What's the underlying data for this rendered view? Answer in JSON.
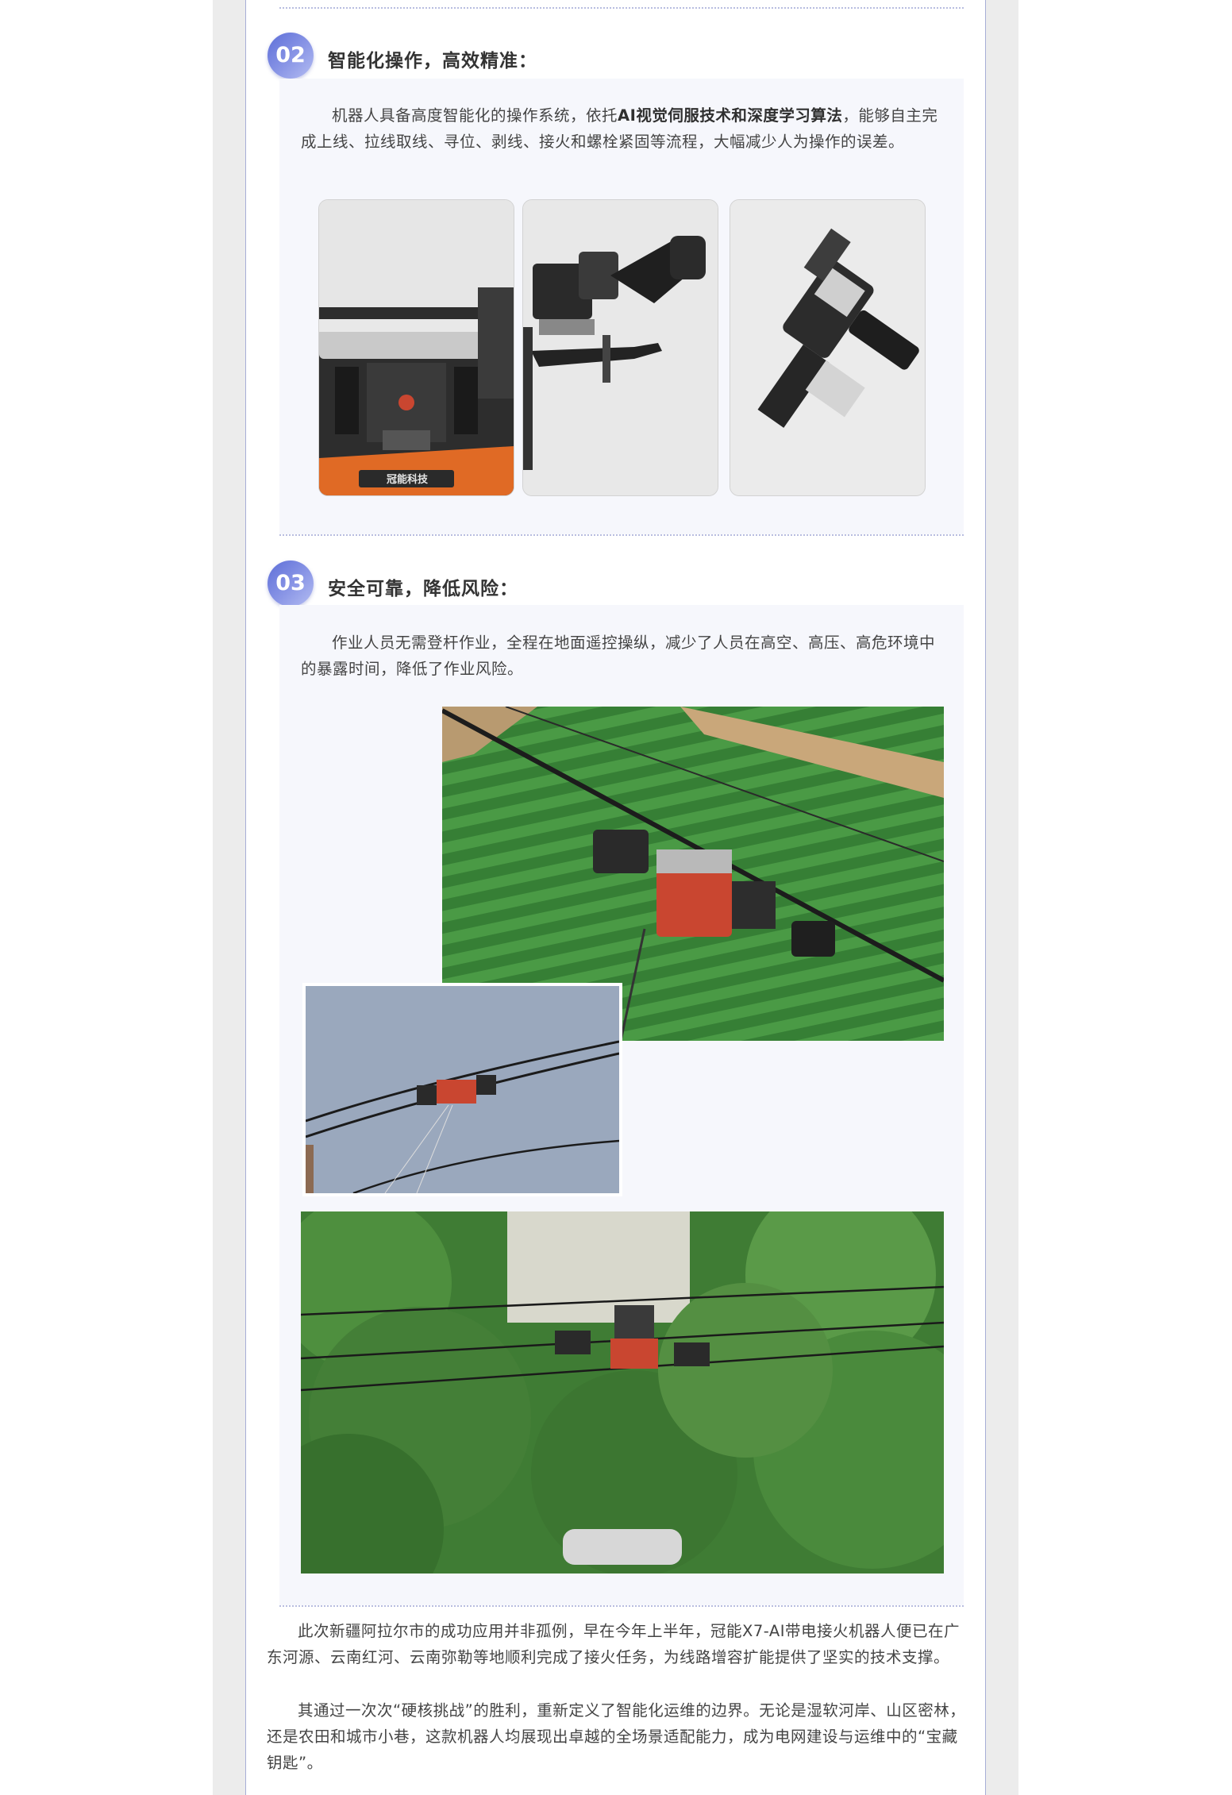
{
  "section02": {
    "number": "02",
    "title": "智能化操作，高效精准：",
    "para_before": "机器人具备高度智能化的操作系统，依托",
    "para_bold": "AI视觉伺服技术和深度学习算法",
    "para_after": "，能够自主完成上线、拉线取线、寻位、剥线、接火和螺栓紧固等流程，大幅减少人为操作的误差。",
    "images": [
      {
        "name": "robot-front-closeup",
        "logo_text": "冠能科技"
      },
      {
        "name": "robot-arm-gripper"
      },
      {
        "name": "robot-wrench-tool"
      }
    ]
  },
  "section03": {
    "number": "03",
    "title": "安全可靠，降低风险：",
    "paragraph": "作业人员无需登杆作业，全程在地面遥控操纵，减少了人员在高空、高压、高危环境中的暴露时间，降低了作业风险。",
    "images": [
      {
        "name": "robot-over-farmland"
      },
      {
        "name": "robot-on-line-sky"
      },
      {
        "name": "robot-among-trees"
      }
    ]
  },
  "closing": {
    "paragraph1": "此次新疆阿拉尔市的成功应用并非孤例，早在今年上半年，冠能X7-AI带电接火机器人便已在广东河源、云南红河、云南弥勒等地顺利完成了接火任务，为线路增容扩能提供了坚实的技术支撑。",
    "paragraph2": "其通过一次次“硬核挑战”的胜利，重新定义了智能化运维的边界。无论是湿软河岸、山区密林，还是农田和城市小巷，这款机器人均展现出卓越的全场景适配能力，成为电网建设与运维中的“宝藏钥匙”。"
  },
  "colors": {
    "badge_gradient": [
      "#5d6ed8",
      "#b4bdf2"
    ],
    "panel_bg": "#f6f7fc",
    "robot_orange": "#e06a25",
    "robot_red": "#c94630"
  }
}
